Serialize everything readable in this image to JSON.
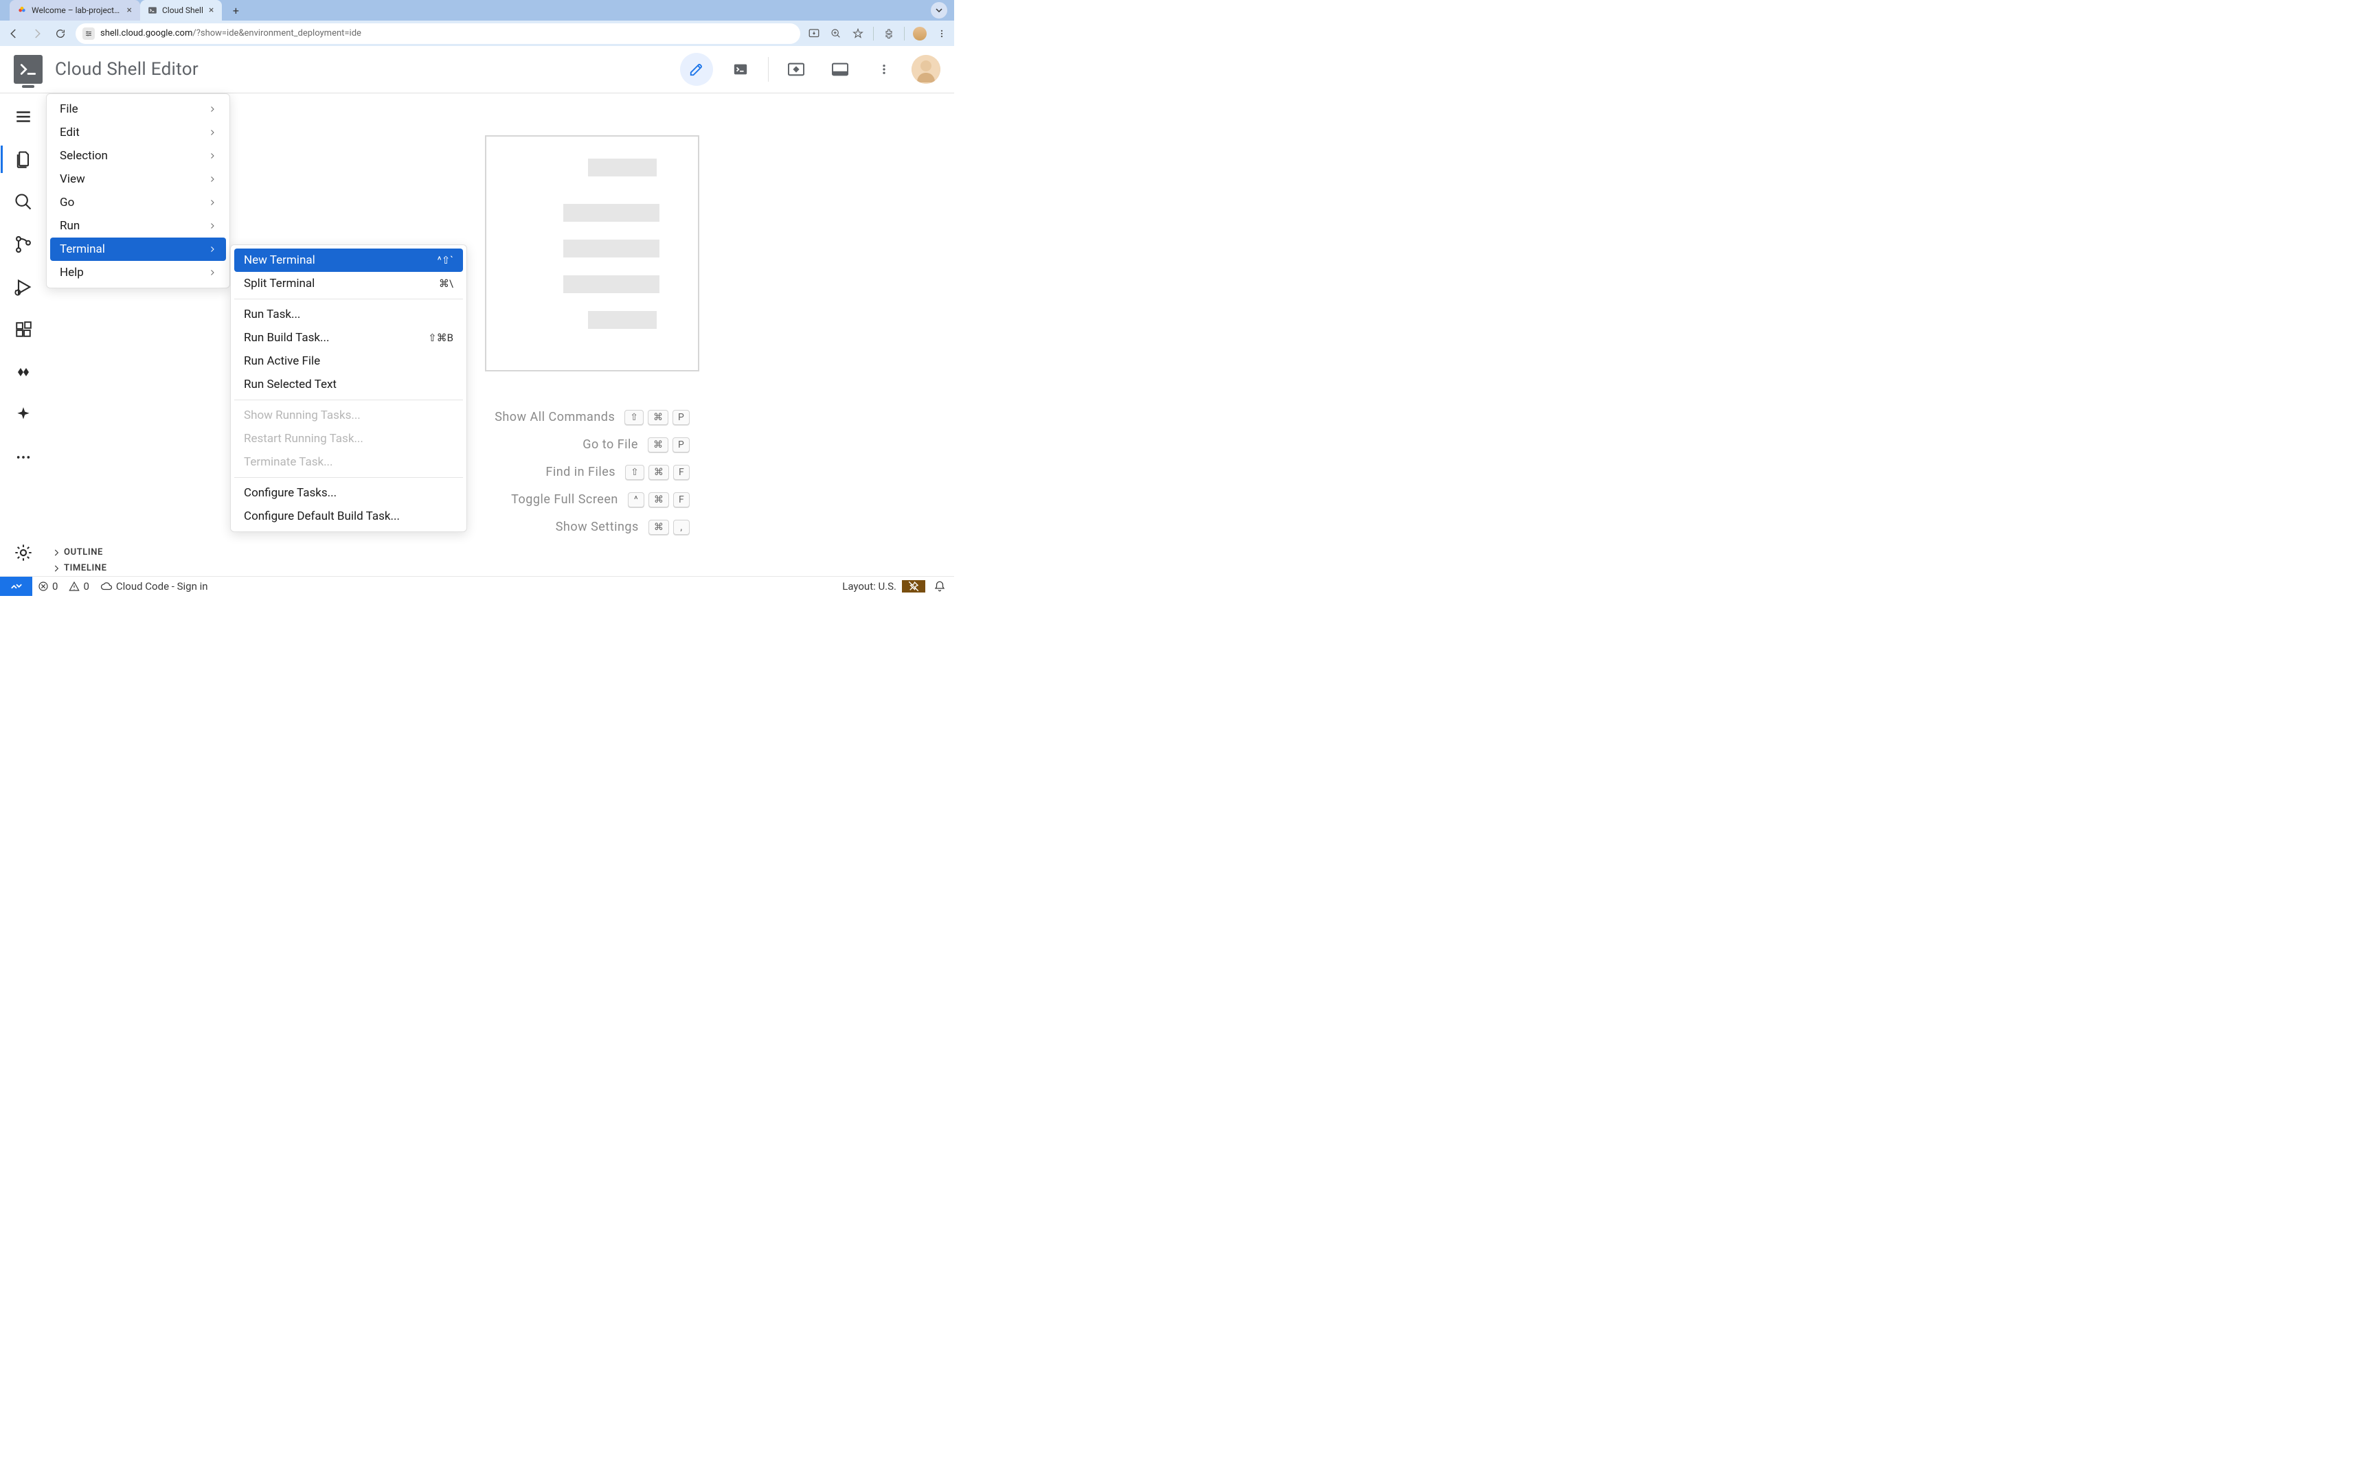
{
  "browser": {
    "tabs": [
      {
        "title": "Welcome – lab-project-id-ex",
        "active": false
      },
      {
        "title": "Cloud Shell",
        "active": true
      }
    ],
    "url_host": "shell.cloud.google.com",
    "url_path": "/?show=ide&environment_deployment=ide"
  },
  "header": {
    "title": "Cloud Shell Editor"
  },
  "main_menu": {
    "items": [
      {
        "label": "File",
        "submenu": true
      },
      {
        "label": "Edit",
        "submenu": true
      },
      {
        "label": "Selection",
        "submenu": true
      },
      {
        "label": "View",
        "submenu": true
      },
      {
        "label": "Go",
        "submenu": true
      },
      {
        "label": "Run",
        "submenu": true
      },
      {
        "label": "Terminal",
        "submenu": true,
        "highlighted": true
      },
      {
        "label": "Help",
        "submenu": true
      }
    ]
  },
  "submenu": {
    "items": [
      {
        "label": "New Terminal",
        "shortcut": "^⇧`",
        "highlighted": true
      },
      {
        "label": "Split Terminal",
        "shortcut": "⌘\\"
      },
      {
        "sep": true
      },
      {
        "label": "Run Task..."
      },
      {
        "label": "Run Build Task...",
        "shortcut": "⇧⌘B"
      },
      {
        "label": "Run Active File"
      },
      {
        "label": "Run Selected Text"
      },
      {
        "sep": true
      },
      {
        "label": "Show Running Tasks...",
        "disabled": true
      },
      {
        "label": "Restart Running Task...",
        "disabled": true
      },
      {
        "label": "Terminate Task...",
        "disabled": true
      },
      {
        "sep": true
      },
      {
        "label": "Configure Tasks..."
      },
      {
        "label": "Configure Default Build Task..."
      }
    ]
  },
  "welcome": {
    "shortcuts": [
      {
        "label": "Show All Commands",
        "keys": [
          "⇧",
          "⌘",
          "P"
        ]
      },
      {
        "label": "Go to File",
        "keys": [
          "⌘",
          "P"
        ]
      },
      {
        "label": "Find in Files",
        "keys": [
          "⇧",
          "⌘",
          "F"
        ]
      },
      {
        "label": "Toggle Full Screen",
        "keys": [
          "^",
          "⌘",
          "F"
        ]
      },
      {
        "label": "Show Settings",
        "keys": [
          "⌘",
          ","
        ]
      }
    ]
  },
  "sidebar": {
    "outline_label": "OUTLINE",
    "timeline_label": "TIMELINE"
  },
  "status": {
    "errors": "0",
    "warnings": "0",
    "cloud_code": "Cloud Code - Sign in",
    "layout": "Layout: U.S."
  }
}
